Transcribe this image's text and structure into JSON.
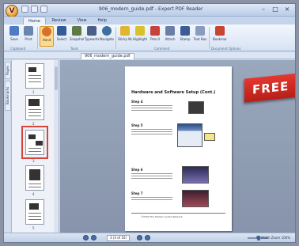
{
  "window": {
    "app_letter": "V",
    "title": "906_modern_guide.pdf - Expert PDF Reader",
    "controls": [
      "–",
      "□",
      "×"
    ]
  },
  "ribbon": {
    "tabs": [
      {
        "label": "Home",
        "active": true
      },
      {
        "label": "Review",
        "active": false
      },
      {
        "label": "View",
        "active": false
      },
      {
        "label": "Help",
        "active": false
      }
    ],
    "buttons": [
      {
        "name": "save-button",
        "label": "Save",
        "color": "#4f7ac4"
      },
      {
        "name": "print-button",
        "label": "Print",
        "color": "#6a85b0"
      },
      {
        "name": "hand-tool-button",
        "label": "Hand",
        "color": "#d8702a",
        "active": true
      },
      {
        "name": "select-button",
        "label": "Select",
        "color": "#355a9a"
      },
      {
        "name": "snapshot-button",
        "label": "Snapshot",
        "color": "#5d7b43"
      },
      {
        "name": "typewriter-button",
        "label": "Typewriter",
        "color": "#4a5f86"
      },
      {
        "name": "zoom-button",
        "label": "Navigate",
        "color": "#3f6f9e"
      },
      {
        "name": "sticky-note-button",
        "label": "Sticky Note",
        "color": "#e2b52f"
      },
      {
        "name": "highlight-button",
        "label": "Highlight",
        "color": "#d8c12a"
      },
      {
        "name": "pencil-button",
        "label": "Pencil",
        "color": "#c6423b"
      },
      {
        "name": "attach-button",
        "label": "Attach",
        "color": "#6b7fa6"
      },
      {
        "name": "stamp-button",
        "label": "Stamp",
        "color": "#3c5c98"
      },
      {
        "name": "text-box-button",
        "label": "Text Box",
        "color": "#8a9bbd"
      },
      {
        "name": "bookmark-button",
        "label": "Bookmark",
        "color": "#c9442f"
      }
    ],
    "groups": [
      "Clipboard",
      "Tools",
      "Comment",
      "Document Options"
    ]
  },
  "document_tab": "906_modern_guide.pdf",
  "side_tabs": [
    "Pages",
    "Bookmarks"
  ],
  "thumbnails": [
    {
      "page": "1"
    },
    {
      "page": "2"
    },
    {
      "page": "3",
      "selected": true
    },
    {
      "page": "4"
    },
    {
      "page": "5"
    }
  ],
  "page_content": {
    "title": "Hardware and Software Setup (Cont.)",
    "steps": [
      "Step 4",
      "Step 5",
      "Step 6",
      "Step 7"
    ],
    "footer": "©2009 The Modern Guide Network"
  },
  "banner": {
    "text": "FREE",
    "color": "#d12b22"
  },
  "statusbar": {
    "page_indicator": "3 (3 of 16)",
    "right_text": "Fit Width  Zoom  100%"
  }
}
